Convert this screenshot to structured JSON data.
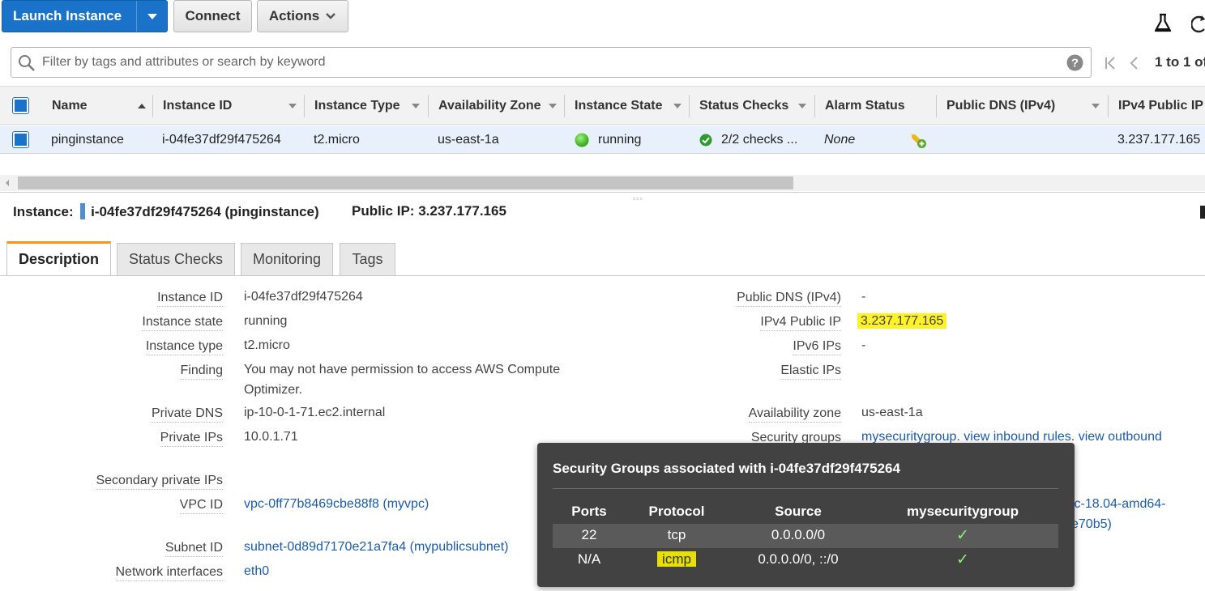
{
  "toolbar": {
    "launch_label": "Launch Instance",
    "connect_label": "Connect",
    "actions_label": "Actions"
  },
  "search": {
    "placeholder": "Filter by tags and attributes or search by keyword",
    "pagination": "1 to 1 of"
  },
  "table": {
    "columns": [
      "Name",
      "Instance ID",
      "Instance Type",
      "Availability Zone",
      "Instance State",
      "Status Checks",
      "Alarm Status",
      "Public DNS (IPv4)",
      "IPv4 Public IP"
    ],
    "row": {
      "name": "pinginstance",
      "instance_id": "i-04fe37df29f475264",
      "instance_type": "t2.micro",
      "availability_zone": "us-east-1a",
      "instance_state": "running",
      "status_checks": "2/2 checks ...",
      "alarm_status": "None",
      "public_dns": "",
      "ipv4_public_ip": "3.237.177.165"
    }
  },
  "detail": {
    "instance_label": "Instance:",
    "instance_value": "i-04fe37df29f475264 (pinginstance)",
    "public_ip_label": "Public IP:",
    "public_ip_value": "3.237.177.165",
    "tabs": [
      "Description",
      "Status Checks",
      "Monitoring",
      "Tags"
    ],
    "left": {
      "instance_id_label": "Instance ID",
      "instance_id": "i-04fe37df29f475264",
      "instance_state_label": "Instance state",
      "instance_state": "running",
      "instance_type_label": "Instance type",
      "instance_type": "t2.micro",
      "finding_label": "Finding",
      "finding_line1": "You may not have permission to access AWS Compute",
      "finding_line2": "Optimizer.",
      "private_dns_label": "Private DNS",
      "private_dns": "ip-10-0-1-71.ec2.internal",
      "private_ips_label": "Private IPs",
      "private_ips": "10.0.1.71",
      "secondary_ips_label": "Secondary private IPs",
      "vpc_id_label": "VPC ID",
      "vpc_id": "vpc-0ff77b8469cbe88f8 (myvpc)",
      "subnet_id_label": "Subnet ID",
      "subnet_id": "subnet-0d89d7170e21a7fa4 (mypublicsubnet)",
      "network_interfaces_label": "Network interfaces",
      "network_interfaces": "eth0"
    },
    "right": {
      "public_dns_label": "Public DNS (IPv4)",
      "public_dns": "-",
      "ipv4_label": "IPv4 Public IP",
      "ipv4": "3.237.177.165",
      "ipv6_label": "IPv6 IPs",
      "ipv6": "-",
      "elastic_label": "Elastic IPs",
      "az_label": "Availability zone",
      "az": "us-east-1a",
      "sg_label": "Security groups",
      "sg_name": "mysecuritygroup",
      "sg_sep1": ". ",
      "sg_inbound": "view inbound rules",
      "sg_sep2": ". ",
      "sg_outbound": "view outbound",
      "ami_partial_1": "ic-18.04-amd64-",
      "ami_partial_2": "e70b5)"
    }
  },
  "popover": {
    "title": "Security Groups associated with i-04fe37df29f475264",
    "headers": [
      "Ports",
      "Protocol",
      "Source",
      "mysecuritygroup"
    ],
    "rows": [
      {
        "ports": "22",
        "protocol": "tcp",
        "source": "0.0.0.0/0",
        "check": "✓"
      },
      {
        "ports": "N/A",
        "protocol": "icmp",
        "source": "0.0.0.0/0, ::/0",
        "check": "✓"
      }
    ]
  },
  "icons": [
    "search-icon",
    "help-icon",
    "first-page-icon",
    "prev-page-icon",
    "flask-icon",
    "refresh-icon",
    "status-running-icon",
    "check-passed-icon",
    "add-alarm-icon"
  ],
  "colors": {
    "primary": "#1a73c9",
    "active_tab": "#f7931e",
    "link": "#1d5ba8",
    "highlight": "#fff12a",
    "running": "#3cb521"
  }
}
